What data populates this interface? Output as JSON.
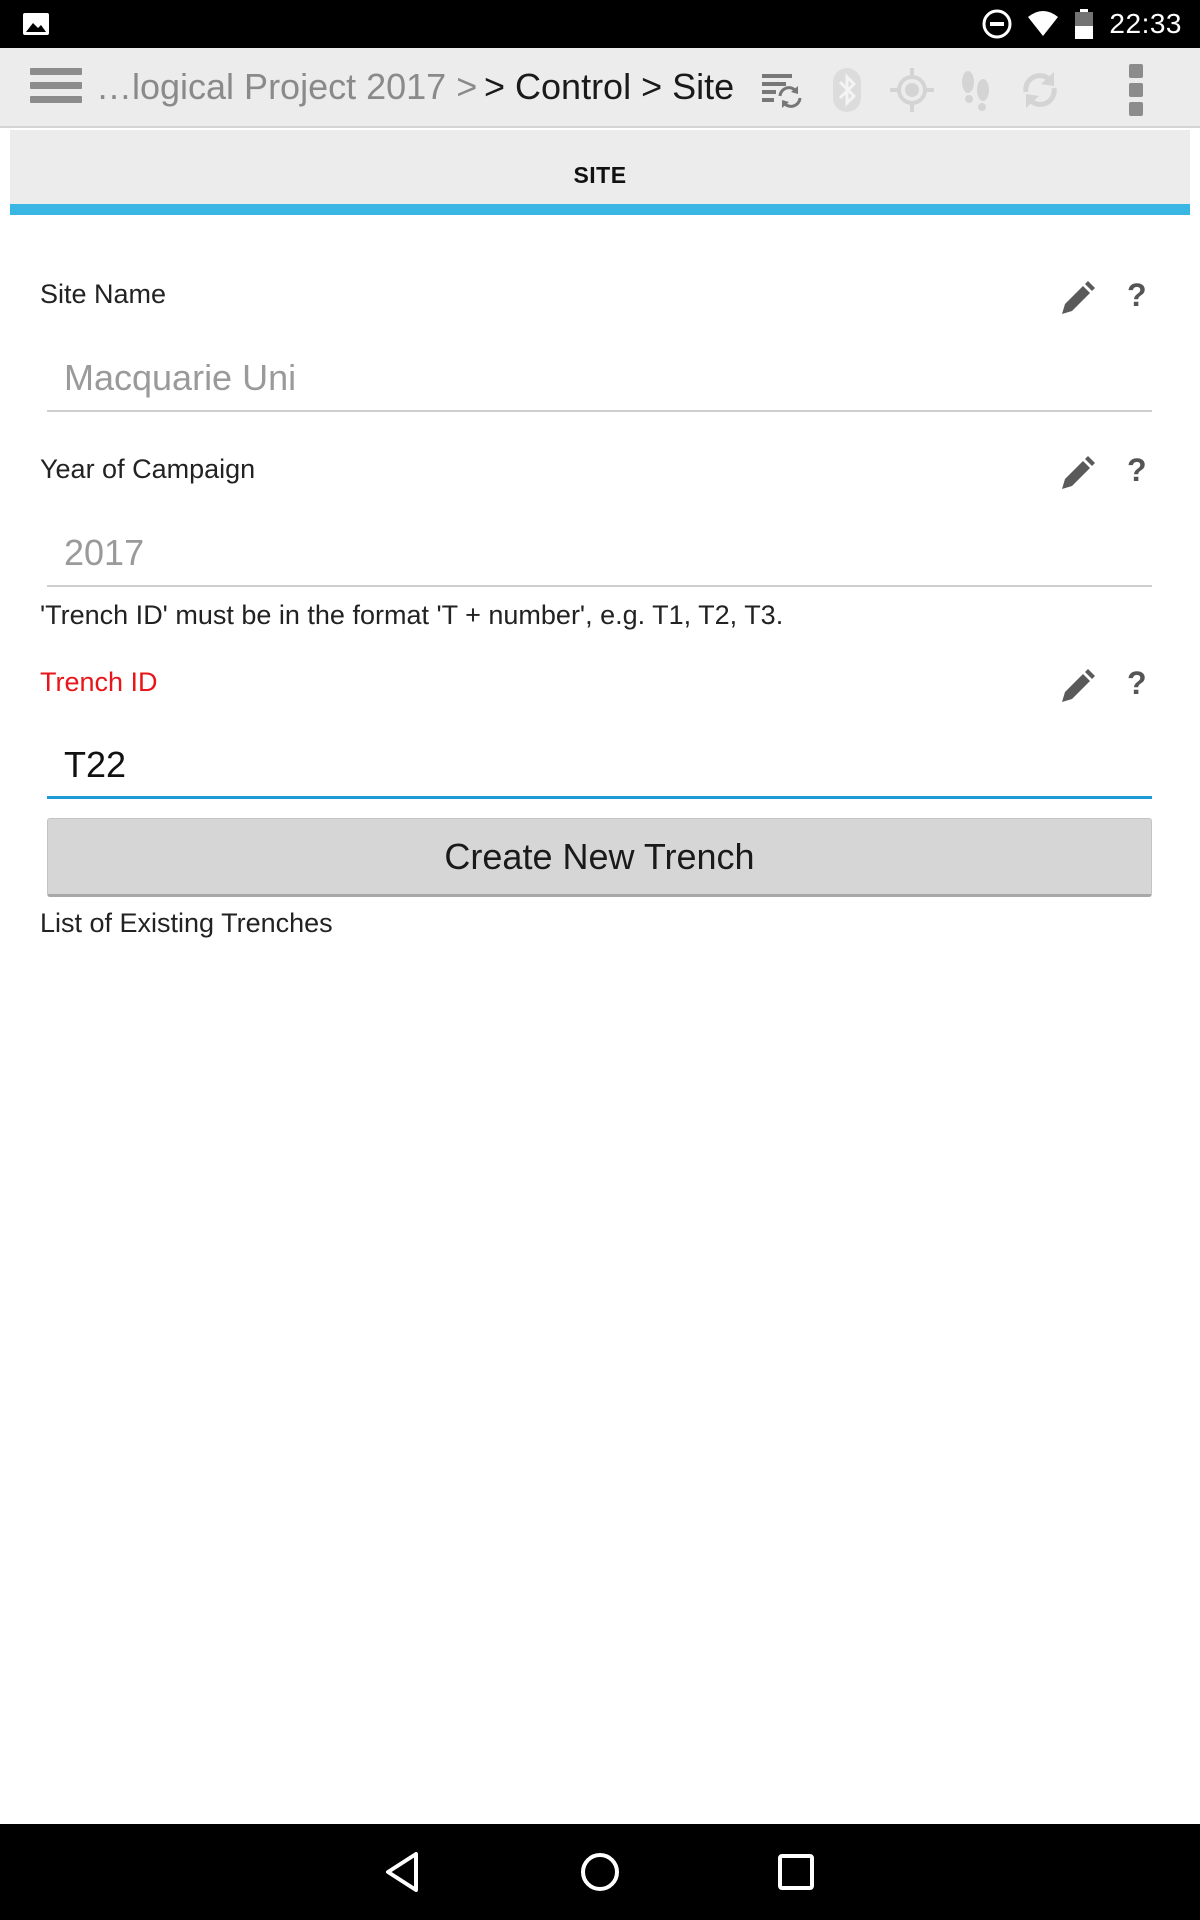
{
  "status_bar": {
    "time": "22:33",
    "icons": [
      "image-notification-icon",
      "do-not-disturb-icon",
      "wifi-icon",
      "battery-icon"
    ]
  },
  "toolbar": {
    "breadcrumb_previous": "…logical Project 2017 >",
    "breadcrumb_current": "> Control > Site",
    "icons": [
      "menu-icon",
      "sync-list-icon",
      "bluetooth-icon",
      "gps-icon",
      "footsteps-icon",
      "refresh-icon",
      "overflow-menu-icon"
    ]
  },
  "tab": {
    "label": "SITE",
    "indicator_color": "#39b6e3"
  },
  "form": {
    "site_name": {
      "label": "Site Name",
      "placeholder": "Macquarie Uni"
    },
    "year_of_campaign": {
      "label": "Year of Campaign",
      "placeholder": "2017"
    },
    "trench_hint": "'Trench ID' must be in the format 'T + number', e.g. T1, T2, T3.",
    "trench_id": {
      "label": "Trench ID",
      "value": "T22",
      "label_color": "#e8151a"
    },
    "create_button": "Create New Trench",
    "list_label": "List of Existing Trenches",
    "help_glyph": "?"
  },
  "nav_bar": {
    "icons": [
      "back-icon",
      "home-icon",
      "recents-icon"
    ]
  }
}
